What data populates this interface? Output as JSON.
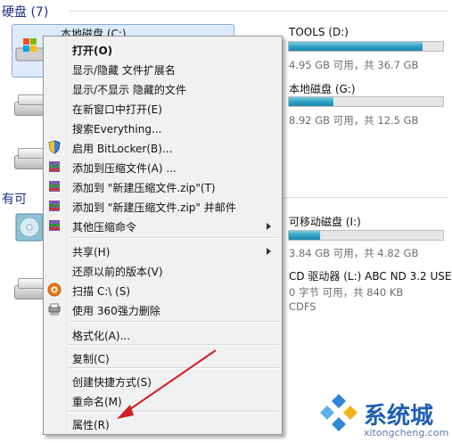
{
  "sections": {
    "hard_disks": "硬盘 (7)",
    "removable_partial": "有可"
  },
  "drives": {
    "c": {
      "name": "本地磁盘 (C:)"
    },
    "d": {
      "name": "TOOLS (D:)",
      "free": "4.95 GB 可用，共 36.7 GB",
      "used_fraction": 0.865
    },
    "g": {
      "name": "本地磁盘 (G:)",
      "free": "8.92 GB 可用，共 12.5 GB",
      "used_fraction": 0.29
    },
    "i": {
      "name": "可移动磁盘 (I:)",
      "free": "3.84 GB 可用，共 4.82 GB",
      "used_fraction": 0.2
    },
    "l": {
      "name": "CD 驱动器 (L:) ABC ND 3.2 USE",
      "free": "0 字节 可用，共 840 KB",
      "fs": "CDFS"
    }
  },
  "menu": {
    "open": "打开(O)",
    "toggle_ext": "显示/隐藏 文件扩展名",
    "toggle_hidden": "显示/不显示 隐藏的文件",
    "open_new_window": "在新窗口中打开(E)",
    "search_everything": "搜索Everything...",
    "bitlocker": "启用 BitLocker(B)...",
    "add_archive": "添加到压缩文件(A) ...",
    "add_zip": "添加到 \"新建压缩文件.zip\"(T)",
    "add_zip_mail": "添加到 \"新建压缩文件.zip\" 并邮件",
    "other_compress": "其他压缩命令",
    "share": "共享(H)",
    "restore": "还原以前的版本(V)",
    "scan": "扫描 C:\\ (S)",
    "shred": "使用 360强力删除",
    "format": "格式化(A)...",
    "copy": "复制(C)",
    "shortcut": "创建快捷方式(S)",
    "rename": "重命名(M)",
    "properties": "属性(R)"
  },
  "watermark": {
    "title": "系统城",
    "url": "xitongcheng.com"
  },
  "colors": {
    "accent": "#1e3287",
    "bar_fill": "#2a9fc4",
    "arrow": "#d21f1f",
    "selection": "#dcecfc"
  }
}
